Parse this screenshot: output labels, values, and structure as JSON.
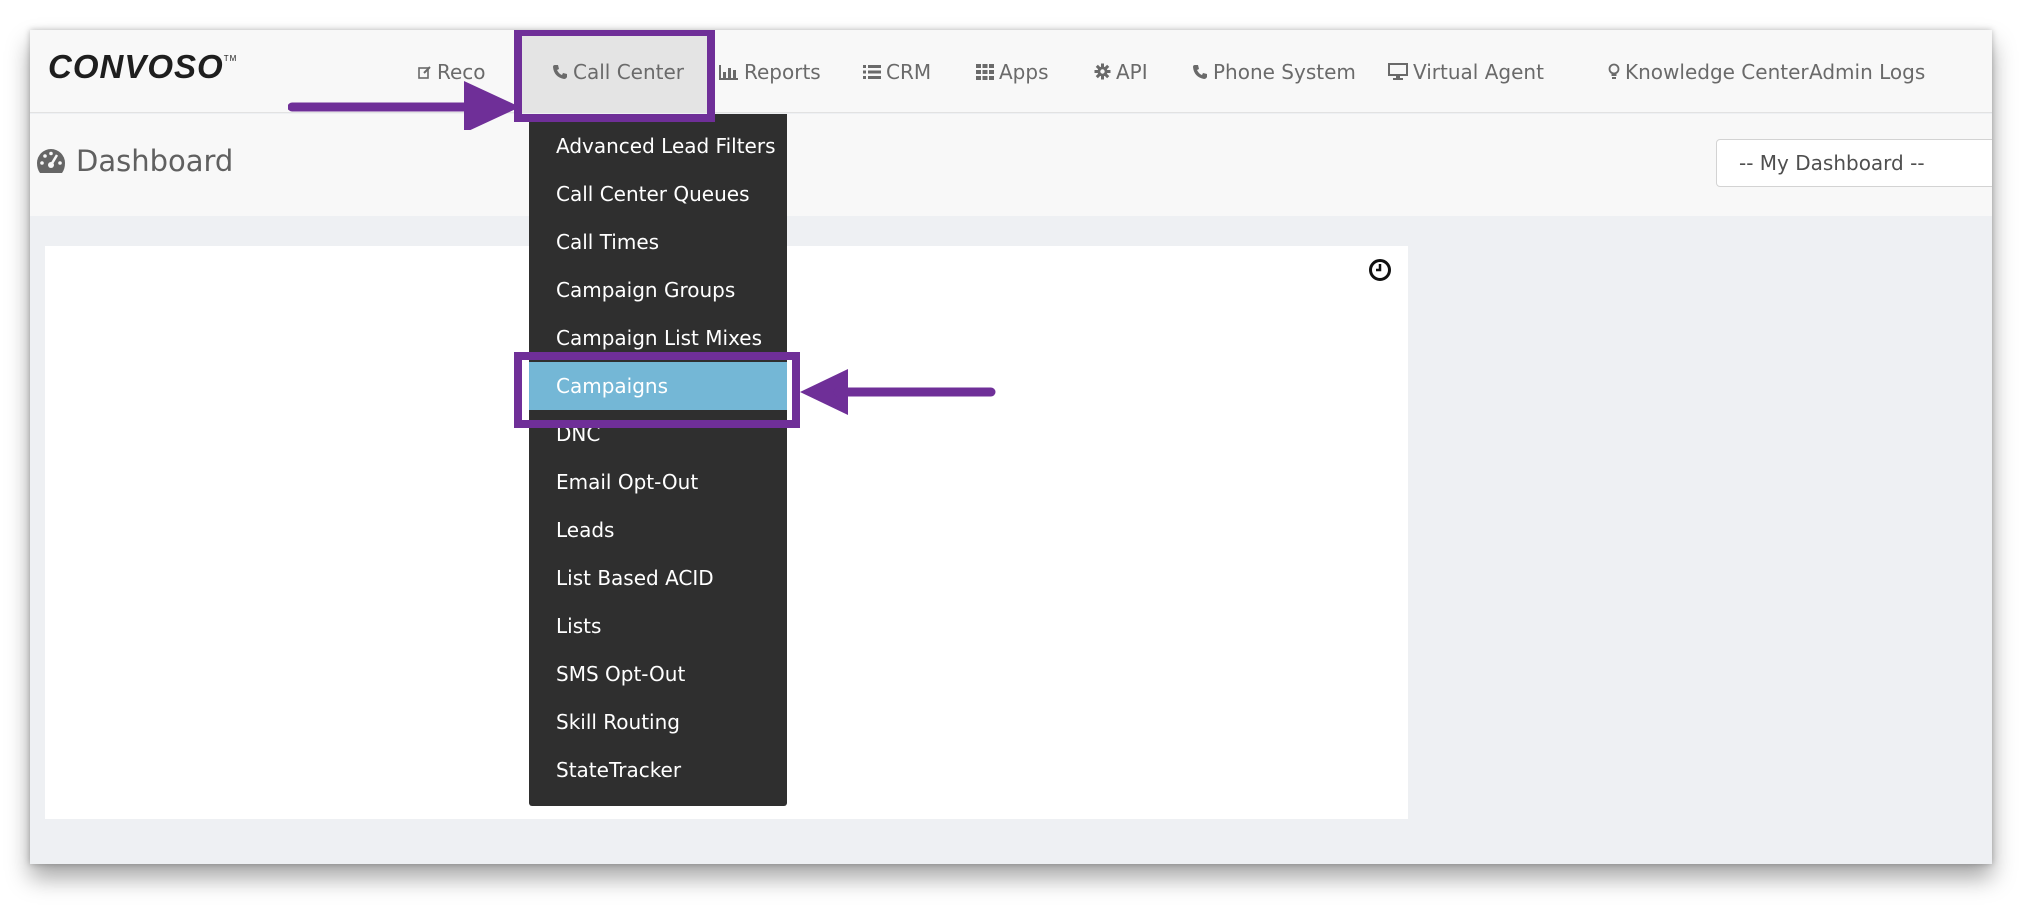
{
  "brand": {
    "logo_text": "CONVOSO"
  },
  "nav": {
    "items": [
      {
        "label": "Reco",
        "icon": "edit-icon"
      },
      {
        "label": "Call Center",
        "icon": "phone-icon"
      },
      {
        "label": "Reports",
        "icon": "bar-chart-icon"
      },
      {
        "label": "CRM",
        "icon": "list-icon"
      },
      {
        "label": "Apps",
        "icon": "grid-icon"
      },
      {
        "label": "API",
        "icon": "gear-icon"
      },
      {
        "label": "Phone System",
        "icon": "phone-icon"
      },
      {
        "label": "Virtual Agent",
        "icon": "monitor-icon"
      },
      {
        "label": "Knowledge Center",
        "icon": "lightbulb-icon"
      },
      {
        "label": "Admin Logs",
        "icon": ""
      }
    ],
    "active": "Call Center"
  },
  "page": {
    "title": "Dashboard",
    "title_icon": "dashboard-gauge-icon",
    "dashboard_select_value": "-- My Dashboard --",
    "panel_icon": "clock-icon"
  },
  "dropdown": {
    "items": [
      "Advanced Lead Filters",
      "Call Center Queues",
      "Call Times",
      "Campaign Groups",
      "Campaign List Mixes",
      "Campaigns",
      "DNC",
      "Email Opt-Out",
      "Leads",
      "List Based ACID",
      "Lists",
      "SMS Opt-Out",
      "Skill Routing",
      "StateTracker"
    ],
    "selected": "Campaigns"
  },
  "annotations": {
    "highlight_color": "#6f2f98",
    "arrows": 2
  },
  "colors": {
    "dropdown_bg": "#2f2f2f",
    "selected_item_bg": "#74b7d6",
    "navbar_bg": "#f8f8f8",
    "annotation": "#6f2f98"
  }
}
